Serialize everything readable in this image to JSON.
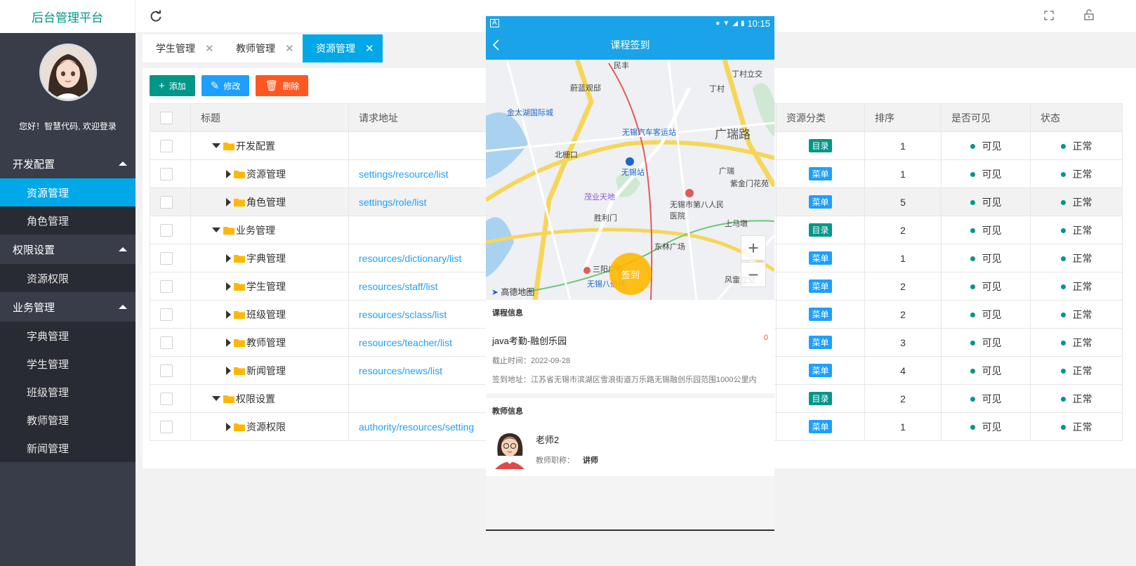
{
  "app": {
    "title": "后台管理平台"
  },
  "user": {
    "welcome": "您好！智慧代码, 欢迎登录"
  },
  "sidebar": {
    "groups": [
      {
        "label": "开发配置",
        "items": [
          {
            "label": "资源管理",
            "active": true
          },
          {
            "label": "角色管理"
          }
        ]
      },
      {
        "label": "权限设置",
        "items": [
          {
            "label": "资源权限"
          }
        ]
      },
      {
        "label": "业务管理",
        "items": [
          {
            "label": "字典管理"
          },
          {
            "label": "学生管理"
          },
          {
            "label": "班级管理"
          },
          {
            "label": "教师管理"
          },
          {
            "label": "新闻管理"
          }
        ]
      }
    ]
  },
  "tabs": [
    {
      "label": "学生管理",
      "close": "✕"
    },
    {
      "label": "教师管理",
      "close": "✕"
    },
    {
      "label": "资源管理",
      "close": "✕",
      "active": true
    }
  ],
  "toolbar": {
    "add": "添加",
    "edit": "修改",
    "delete": "删除"
  },
  "table": {
    "headers": {
      "title": "标题",
      "url": "请求地址",
      "category": "资源分类",
      "sort": "排序",
      "visible": "是否可见",
      "status": "状态"
    },
    "rows": [
      {
        "title": "开发配置",
        "level": 0,
        "url": "",
        "category": "目录",
        "type": "dir",
        "sort": "1",
        "visible": "可见",
        "status": "正常"
      },
      {
        "title": "资源管理",
        "level": 1,
        "url": "settings/resource/list",
        "category": "菜单",
        "type": "menu",
        "sort": "1",
        "visible": "可见",
        "status": "正常"
      },
      {
        "title": "角色管理",
        "level": 1,
        "url": "settings/role/list",
        "category": "菜单",
        "type": "menu",
        "sort": "5",
        "visible": "可见",
        "status": "正常"
      },
      {
        "title": "业务管理",
        "level": 0,
        "url": "",
        "category": "目录",
        "type": "dir",
        "sort": "2",
        "visible": "可见",
        "status": "正常"
      },
      {
        "title": "字典管理",
        "level": 1,
        "url": "resources/dictionary/list",
        "category": "菜单",
        "type": "menu",
        "sort": "1",
        "visible": "可见",
        "status": "正常"
      },
      {
        "title": "学生管理",
        "level": 1,
        "url": "resources/staff/list",
        "category": "菜单",
        "type": "menu",
        "sort": "2",
        "visible": "可见",
        "status": "正常"
      },
      {
        "title": "班级管理",
        "level": 1,
        "url": "resources/sclass/list",
        "category": "菜单",
        "type": "menu",
        "sort": "2",
        "visible": "可见",
        "status": "正常"
      },
      {
        "title": "教师管理",
        "level": 1,
        "url": "resources/teacher/list",
        "category": "菜单",
        "type": "menu",
        "sort": "3",
        "visible": "可见",
        "status": "正常"
      },
      {
        "title": "新闻管理",
        "level": 1,
        "url": "resources/news/list",
        "category": "菜单",
        "type": "menu",
        "sort": "4",
        "visible": "可见",
        "status": "正常"
      },
      {
        "title": "权限设置",
        "level": 0,
        "url": "",
        "category": "目录",
        "type": "dir",
        "sort": "2",
        "visible": "可见",
        "status": "正常"
      },
      {
        "title": "资源权限",
        "level": 1,
        "url": "authority/resources/setting",
        "category": "菜单",
        "type": "menu",
        "sort": "1",
        "visible": "可见",
        "status": "正常"
      }
    ]
  },
  "phone": {
    "time": "10:15",
    "page_title": "课程签到",
    "map_labels": [
      "民丰",
      "丁村立交",
      "蔚蓝观邸",
      "丁村",
      "金太湖国际城",
      "无锡汽车客运站",
      "广瑞路",
      "北栅口",
      "无锡站",
      "广瑞",
      "紫金门花苑",
      "茂业天地",
      "无锡市第八人民医院",
      "胜利门",
      "上马墩",
      "东林广场",
      "三阳广场",
      "无锡八佰伴",
      "风雷立交",
      "高德地图"
    ],
    "zoom_in": "+",
    "zoom_out": "−",
    "checkin_button": "签到",
    "course_section": "课程信息",
    "course_name": "java考勤-融创乐园",
    "course_count": "0",
    "deadline": "截止时间：2022-09-28",
    "address": "签到地址：江苏省无锡市滨湖区雪浪街道万乐路无锡融创乐园范围1000公里内",
    "teacher_section": "教师信息",
    "teacher_name": "老师2",
    "teacher_title_label": "教师职称：",
    "teacher_title": "讲师"
  },
  "colors": {
    "accent": "#00a8e8",
    "primary": "#009688",
    "blue": "#1e9fff",
    "danger": "#ff5722",
    "sidebar": "#393d49"
  }
}
